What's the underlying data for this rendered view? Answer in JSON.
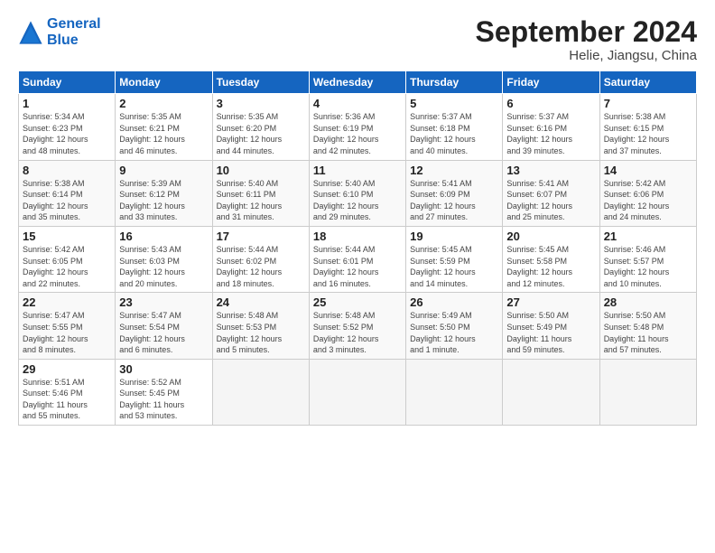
{
  "logo": {
    "line1": "General",
    "line2": "Blue"
  },
  "title": "September 2024",
  "subtitle": "Helie, Jiangsu, China",
  "days_of_week": [
    "Sunday",
    "Monday",
    "Tuesday",
    "Wednesday",
    "Thursday",
    "Friday",
    "Saturday"
  ],
  "weeks": [
    [
      {
        "num": "1",
        "info": "Sunrise: 5:34 AM\nSunset: 6:23 PM\nDaylight: 12 hours\nand 48 minutes."
      },
      {
        "num": "2",
        "info": "Sunrise: 5:35 AM\nSunset: 6:21 PM\nDaylight: 12 hours\nand 46 minutes."
      },
      {
        "num": "3",
        "info": "Sunrise: 5:35 AM\nSunset: 6:20 PM\nDaylight: 12 hours\nand 44 minutes."
      },
      {
        "num": "4",
        "info": "Sunrise: 5:36 AM\nSunset: 6:19 PM\nDaylight: 12 hours\nand 42 minutes."
      },
      {
        "num": "5",
        "info": "Sunrise: 5:37 AM\nSunset: 6:18 PM\nDaylight: 12 hours\nand 40 minutes."
      },
      {
        "num": "6",
        "info": "Sunrise: 5:37 AM\nSunset: 6:16 PM\nDaylight: 12 hours\nand 39 minutes."
      },
      {
        "num": "7",
        "info": "Sunrise: 5:38 AM\nSunset: 6:15 PM\nDaylight: 12 hours\nand 37 minutes."
      }
    ],
    [
      {
        "num": "8",
        "info": "Sunrise: 5:38 AM\nSunset: 6:14 PM\nDaylight: 12 hours\nand 35 minutes."
      },
      {
        "num": "9",
        "info": "Sunrise: 5:39 AM\nSunset: 6:12 PM\nDaylight: 12 hours\nand 33 minutes."
      },
      {
        "num": "10",
        "info": "Sunrise: 5:40 AM\nSunset: 6:11 PM\nDaylight: 12 hours\nand 31 minutes."
      },
      {
        "num": "11",
        "info": "Sunrise: 5:40 AM\nSunset: 6:10 PM\nDaylight: 12 hours\nand 29 minutes."
      },
      {
        "num": "12",
        "info": "Sunrise: 5:41 AM\nSunset: 6:09 PM\nDaylight: 12 hours\nand 27 minutes."
      },
      {
        "num": "13",
        "info": "Sunrise: 5:41 AM\nSunset: 6:07 PM\nDaylight: 12 hours\nand 25 minutes."
      },
      {
        "num": "14",
        "info": "Sunrise: 5:42 AM\nSunset: 6:06 PM\nDaylight: 12 hours\nand 24 minutes."
      }
    ],
    [
      {
        "num": "15",
        "info": "Sunrise: 5:42 AM\nSunset: 6:05 PM\nDaylight: 12 hours\nand 22 minutes."
      },
      {
        "num": "16",
        "info": "Sunrise: 5:43 AM\nSunset: 6:03 PM\nDaylight: 12 hours\nand 20 minutes."
      },
      {
        "num": "17",
        "info": "Sunrise: 5:44 AM\nSunset: 6:02 PM\nDaylight: 12 hours\nand 18 minutes."
      },
      {
        "num": "18",
        "info": "Sunrise: 5:44 AM\nSunset: 6:01 PM\nDaylight: 12 hours\nand 16 minutes."
      },
      {
        "num": "19",
        "info": "Sunrise: 5:45 AM\nSunset: 5:59 PM\nDaylight: 12 hours\nand 14 minutes."
      },
      {
        "num": "20",
        "info": "Sunrise: 5:45 AM\nSunset: 5:58 PM\nDaylight: 12 hours\nand 12 minutes."
      },
      {
        "num": "21",
        "info": "Sunrise: 5:46 AM\nSunset: 5:57 PM\nDaylight: 12 hours\nand 10 minutes."
      }
    ],
    [
      {
        "num": "22",
        "info": "Sunrise: 5:47 AM\nSunset: 5:55 PM\nDaylight: 12 hours\nand 8 minutes."
      },
      {
        "num": "23",
        "info": "Sunrise: 5:47 AM\nSunset: 5:54 PM\nDaylight: 12 hours\nand 6 minutes."
      },
      {
        "num": "24",
        "info": "Sunrise: 5:48 AM\nSunset: 5:53 PM\nDaylight: 12 hours\nand 5 minutes."
      },
      {
        "num": "25",
        "info": "Sunrise: 5:48 AM\nSunset: 5:52 PM\nDaylight: 12 hours\nand 3 minutes."
      },
      {
        "num": "26",
        "info": "Sunrise: 5:49 AM\nSunset: 5:50 PM\nDaylight: 12 hours\nand 1 minute."
      },
      {
        "num": "27",
        "info": "Sunrise: 5:50 AM\nSunset: 5:49 PM\nDaylight: 11 hours\nand 59 minutes."
      },
      {
        "num": "28",
        "info": "Sunrise: 5:50 AM\nSunset: 5:48 PM\nDaylight: 11 hours\nand 57 minutes."
      }
    ],
    [
      {
        "num": "29",
        "info": "Sunrise: 5:51 AM\nSunset: 5:46 PM\nDaylight: 11 hours\nand 55 minutes."
      },
      {
        "num": "30",
        "info": "Sunrise: 5:52 AM\nSunset: 5:45 PM\nDaylight: 11 hours\nand 53 minutes."
      },
      {
        "num": "",
        "info": ""
      },
      {
        "num": "",
        "info": ""
      },
      {
        "num": "",
        "info": ""
      },
      {
        "num": "",
        "info": ""
      },
      {
        "num": "",
        "info": ""
      }
    ]
  ]
}
